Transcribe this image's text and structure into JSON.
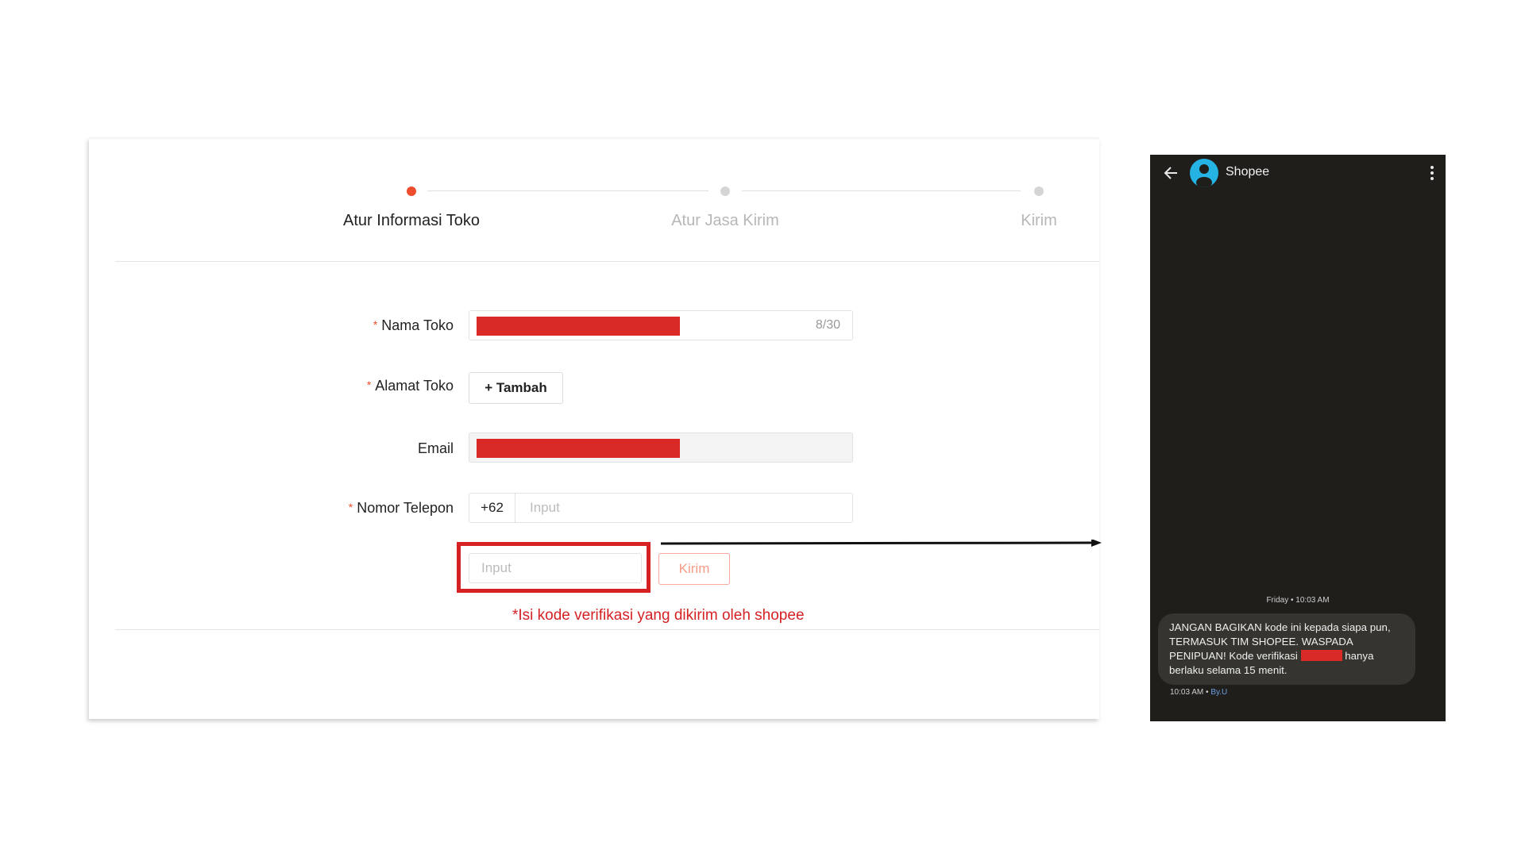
{
  "stepper": {
    "steps": [
      {
        "label": "Atur Informasi Toko",
        "active": true
      },
      {
        "label": "Atur Jasa Kirim",
        "active": false
      },
      {
        "label": "Kirim",
        "active": false
      }
    ]
  },
  "form": {
    "shop_name": {
      "label": "Nama Toko",
      "required": true,
      "counter": "8/30"
    },
    "shop_address": {
      "label": "Alamat Toko",
      "required": true,
      "button": "+ Tambah"
    },
    "email": {
      "label": "Email"
    },
    "phone": {
      "label": "Nomor Telepon",
      "required": true,
      "prefix": "+62",
      "placeholder": "Input"
    },
    "otp": {
      "placeholder": "Input",
      "send_button": "Kirim"
    },
    "required_mark": "*",
    "note": "*Isi kode verifikasi yang dikirim oleh shopee"
  },
  "sms": {
    "contact": "Shopee",
    "day_time": "Friday • 10:03 AM",
    "message_part1": "JANGAN BAGIKAN kode ini kepada siapa pun, TERMASUK TIM SHOPEE. WASPADA PENIPUAN! Kode verifikasi",
    "message_part2": "hanya berlaku selama 15 menit.",
    "time": "10:03 AM",
    "separator": "•",
    "carrier": "By.U"
  },
  "colors": {
    "accent": "#ee4d2d",
    "redaction": "#d92a27",
    "highlight": "#d52124",
    "phone_bg": "#1f1e1b",
    "avatar": "#25b3e3"
  }
}
